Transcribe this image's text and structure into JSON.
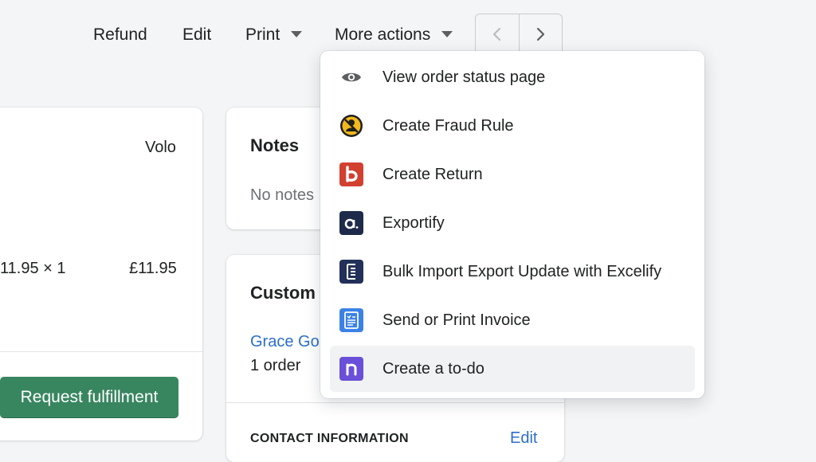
{
  "toolbar": {
    "refund_label": "Refund",
    "edit_label": "Edit",
    "print_label": "Print",
    "more_actions_label": "More actions"
  },
  "order_card": {
    "vendor": "Volo",
    "price_qty": "11.95 × 1",
    "line_total": "£11.95",
    "fulfill_button": "Request fulfillment"
  },
  "notes": {
    "title": "Notes",
    "empty_text": "No notes"
  },
  "customer": {
    "title": "Custom",
    "name_link": "Grace Go",
    "orders": "1 order",
    "contact_heading": "CONTACT INFORMATION",
    "contact_edit": "Edit"
  },
  "menu": {
    "items": [
      {
        "label": "View order status page",
        "icon": "eye-icon"
      },
      {
        "label": "Create Fraud Rule",
        "icon": "fraud-rule-icon"
      },
      {
        "label": "Create Return",
        "icon": "return-app-icon"
      },
      {
        "label": "Exportify",
        "icon": "exportify-icon"
      },
      {
        "label": "Bulk Import Export Update with Excelify",
        "icon": "excelify-icon"
      },
      {
        "label": "Send or Print Invoice",
        "icon": "invoice-icon"
      },
      {
        "label": "Create a to-do",
        "icon": "todo-app-icon"
      }
    ]
  },
  "colors": {
    "primary_green": "#388660",
    "link_blue": "#2c6ecb",
    "return_red": "#d2402f",
    "todo_purple": "#6a4fd8",
    "exportify_navy": "#1e2a4a",
    "invoice_blue": "#3b82e6",
    "fraud_yellow": "#f1b81c"
  }
}
